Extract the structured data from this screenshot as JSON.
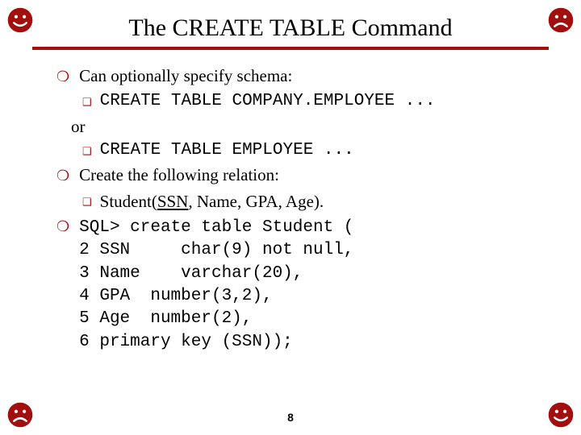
{
  "title": "The CREATE TABLE Command",
  "bullets": {
    "b1": "Can optionally specify schema:",
    "b1a": "CREATE TABLE COMPANY.EMPLOYEE ...",
    "or": "or",
    "b1b": "CREATE TABLE EMPLOYEE ...",
    "b2": "Create the following relation:",
    "b2a_prefix": "Student(",
    "b2a_ssn": "SSN",
    "b2a_suffix": ", Name, GPA, Age).",
    "sql_prompt": "SQL>",
    "sql_line1": " create table Student (",
    "sql_line2": "2 SSN     char(9) not null,",
    "sql_line3": "3 Name    varchar(20),",
    "sql_line4": "4 GPA  number(3,2),",
    "sql_line5": "5 Age  number(2),",
    "sql_line6": "6 primary key (SSN));"
  },
  "page_number": "8",
  "icons": {
    "tl": "smile-icon",
    "tr": "sad-icon",
    "bl": "sad-icon",
    "br": "smile-icon"
  }
}
